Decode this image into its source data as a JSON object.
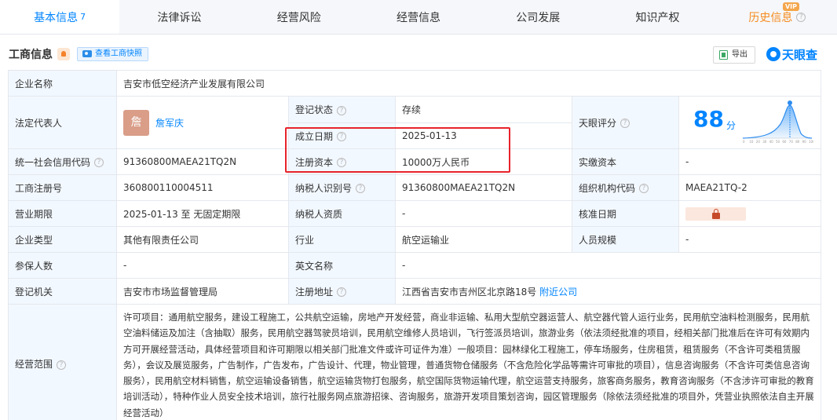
{
  "tabs": [
    {
      "label": "基本信息",
      "count": "7"
    },
    {
      "label": "法律诉讼"
    },
    {
      "label": "经营风险"
    },
    {
      "label": "经营信息"
    },
    {
      "label": "公司发展"
    },
    {
      "label": "知识产权"
    },
    {
      "label": "历史信息",
      "badge": "VIP"
    }
  ],
  "section": {
    "title": "工商信息",
    "snapshot_button": "查看工商快照",
    "export_button": "导出",
    "logo_text": "天眼查"
  },
  "company": {
    "name_label": "企业名称",
    "name": "吉安市低空经济产业发展有限公司",
    "legal_rep_label": "法定代表人",
    "legal_rep_avatar": "詹",
    "legal_rep": "詹军庆",
    "reg_status_label": "登记状态",
    "reg_status": "存续",
    "score_label": "天眼评分",
    "score": "88",
    "score_unit": "分",
    "score_axis": [
      "0",
      "10",
      "20",
      "30",
      "40",
      "50",
      "60",
      "70",
      "80",
      "90",
      "100"
    ],
    "est_date_label": "成立日期",
    "est_date": "2025-01-13",
    "credit_code_label": "统一社会信用代码",
    "credit_code": "91360800MAEA21TQ2N",
    "reg_capital_label": "注册资本",
    "reg_capital": "10000万人民币",
    "paid_capital_label": "实缴资本",
    "paid_capital": "-",
    "reg_no_label": "工商注册号",
    "reg_no": "360800110004511",
    "taxpayer_id_label": "纳税人识别号",
    "taxpayer_id": "91360800MAEA21TQ2N",
    "org_code_label": "组织机构代码",
    "org_code": "MAEA21TQ-2",
    "term_label": "营业期限",
    "term": "2025-01-13 至 无固定期限",
    "taxpayer_qual_label": "纳税人资质",
    "taxpayer_qual": "-",
    "approval_date_label": "核准日期",
    "type_label": "企业类型",
    "type": "其他有限责任公司",
    "industry_label": "行业",
    "industry": "航空运输业",
    "staff_label": "人员规模",
    "staff": "-",
    "insured_label": "参保人数",
    "insured": "-",
    "en_name_label": "英文名称",
    "en_name": "-",
    "authority_label": "登记机关",
    "authority": "吉安市市场监督管理局",
    "address_label": "注册地址",
    "address": "江西省吉安市吉州区北京路18号",
    "nearby_link": "附近公司",
    "scope_label": "经营范围",
    "scope": "许可项目：通用航空服务，建设工程施工，公共航空运输，房地产开发经营，商业非运输、私用大型航空器运营人、航空器代管人运行业务，民用航空油料检测服务，民用航空油料储运及加注（含抽取）服务，民用航空器驾驶员培训，民用航空维修人员培训，飞行签派员培训，旅游业务（依法须经批准的项目，经相关部门批准后在许可有效期内方可开展经营活动，具体经营项目和许可期限以相关部门批准文件或许可证件为准）一般项目：园林绿化工程施工，停车场服务，住房租赁，租赁服务（不含许可类租赁服务），会议及展览服务，广告制作，广告发布，广告设计、代理，物业管理，普通货物仓储服务（不含危险化学品等需许可审批的项目），信息咨询服务（不含许可类信息咨询服务），民用航空材料销售，航空运输设备销售，航空运输货物打包服务，航空国际货物运输代理，航空运营支持服务，旅客商务服务，教育咨询服务（不含涉许可审批的教育培训活动），特种作业人员安全技术培训，旅行社服务网点旅游招徕、咨询服务，旅游开发项目策划咨询，园区管理服务（除依法须经批准的项目外，凭营业执照依法自主开展经营活动）"
  },
  "colors": {
    "accent": "#0084ff",
    "label_bg": "#f2f8ff",
    "highlight": "#e8232b",
    "status_green": "#1aad3c",
    "history_orange": "#f68b1f"
  }
}
